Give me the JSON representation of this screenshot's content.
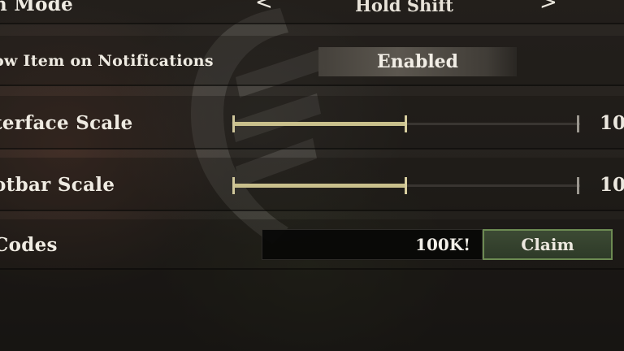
{
  "settings": {
    "selector_row": {
      "label": "n Mode",
      "value": "Hold Shift",
      "prev_arrow": "<",
      "next_arrow": ">"
    },
    "notifications_row": {
      "label": "ow Item on Notifications",
      "value": "Enabled"
    },
    "interface_scale": {
      "label": "terface Scale",
      "value_text": "10",
      "fill_fraction": 0.5
    },
    "hotbar_scale": {
      "label": "otbar Scale",
      "value_text": "10",
      "fill_fraction": 0.5
    },
    "codes_row": {
      "label": "Codes",
      "input_value": "100K!",
      "claim_label": "Claim"
    }
  },
  "colors": {
    "slider_fill": "#c9c08c",
    "claim_border": "#6c8a52",
    "text": "#ece8df"
  },
  "icons": {
    "prev": "chevron-left-icon",
    "next": "chevron-right-icon",
    "background_emblem": "emblem-icon"
  }
}
